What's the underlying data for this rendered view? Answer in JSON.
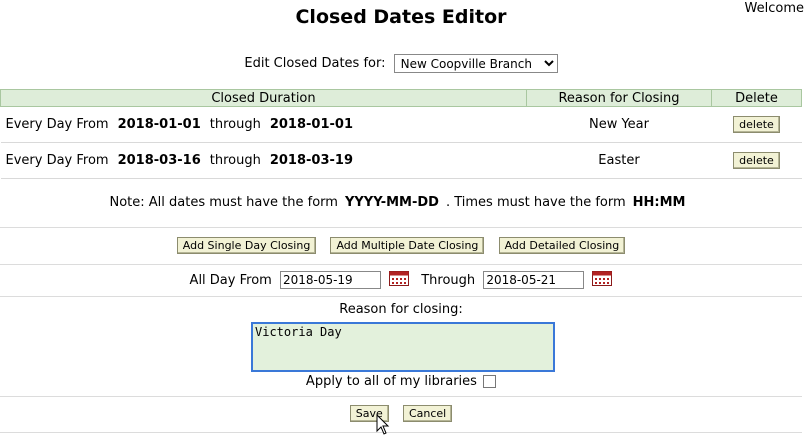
{
  "header": {
    "welcome": "Welcome",
    "title": "Closed Dates Editor"
  },
  "branch": {
    "label": "Edit Closed Dates for:",
    "selected": "New Coopville Branch",
    "caret": "▼"
  },
  "table": {
    "headers": {
      "duration": "Closed Duration",
      "reason": "Reason for Closing",
      "delete": "Delete"
    },
    "rows": [
      {
        "prefix": "Every Day From",
        "from": "2018-01-01",
        "through": "through",
        "to": "2018-01-01",
        "reason": "New Year",
        "delete": "delete"
      },
      {
        "prefix": "Every Day From",
        "from": "2018-03-16",
        "through": "through",
        "to": "2018-03-19",
        "reason": "Easter",
        "delete": "delete"
      }
    ]
  },
  "note": {
    "text1": "Note: All dates must have the form",
    "date_format": "YYYY-MM-DD",
    "text2": ". Times must have the form",
    "time_format": "HH:MM"
  },
  "add_buttons": {
    "single": "Add Single Day Closing",
    "multiple": "Add Multiple Date Closing",
    "detailed": "Add Detailed Closing"
  },
  "range": {
    "from_label": "All Day From",
    "from_value": "2018-05-19",
    "through_label": "Through",
    "through_value": "2018-05-21"
  },
  "reason_form": {
    "label": "Reason for closing:",
    "value": "Victoria Day",
    "apply_label": "Apply to all of my libraries",
    "apply_checked": false
  },
  "actions": {
    "save": "Save",
    "cancel": "Cancel"
  },
  "colors": {
    "header_bg": "#deedd9",
    "button_bg": "#f2f2d5",
    "textarea_bg": "#e3f1dc",
    "focus_border": "#3a78d8"
  },
  "icons": {
    "calendar": "calendar-icon",
    "cursor": "mouse-pointer-icon"
  }
}
